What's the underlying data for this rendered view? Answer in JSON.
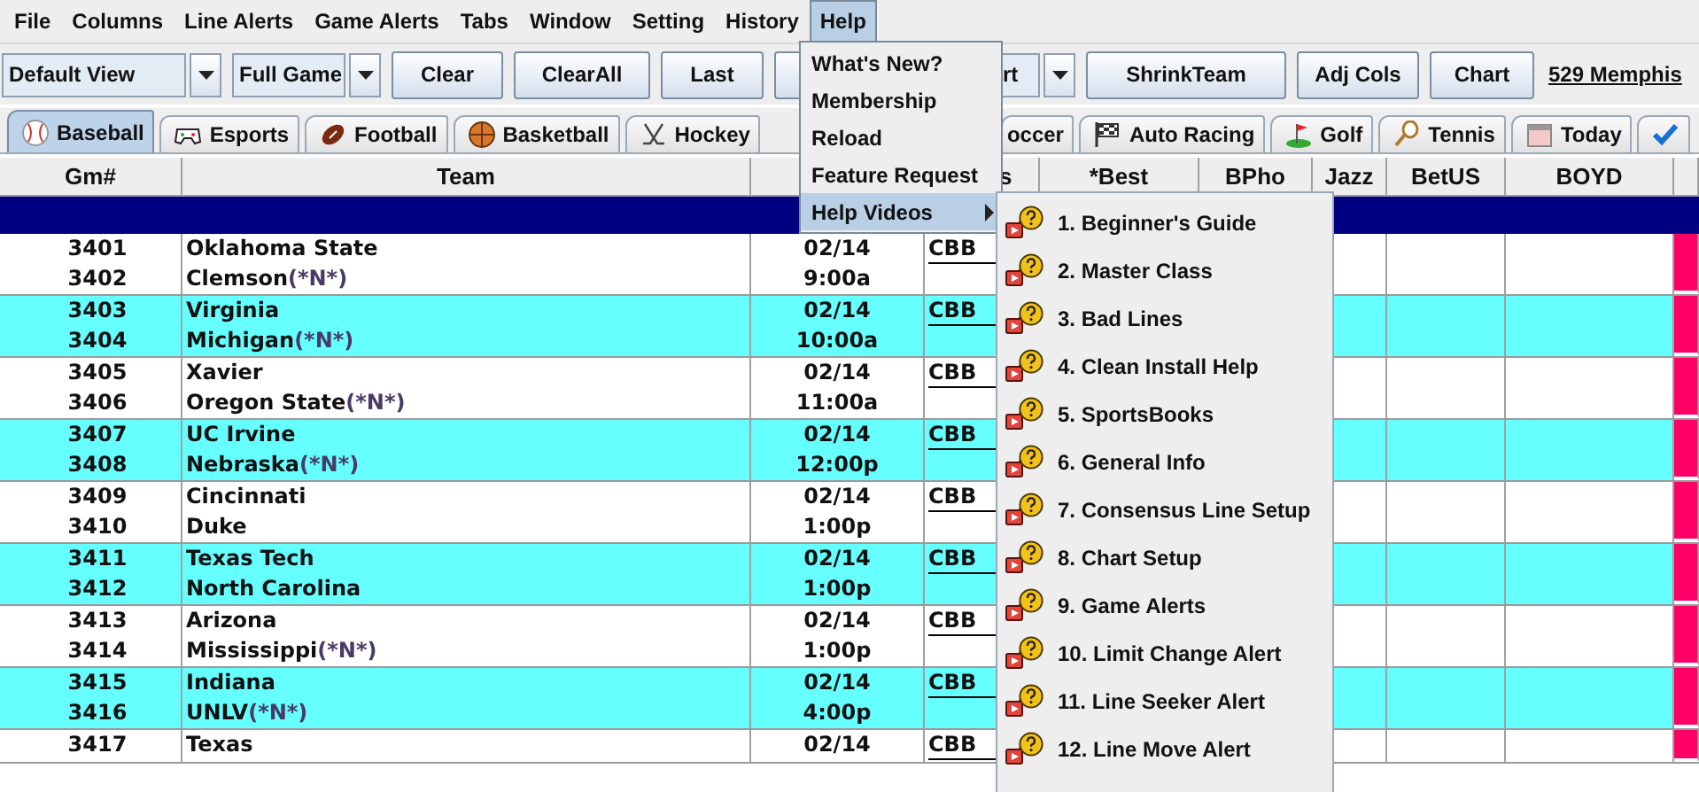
{
  "menubar": [
    {
      "label": "File",
      "selected": false
    },
    {
      "label": "Columns",
      "selected": false
    },
    {
      "label": "Line Alerts",
      "selected": false
    },
    {
      "label": "Game Alerts",
      "selected": false
    },
    {
      "label": "Tabs",
      "selected": false
    },
    {
      "label": "Window",
      "selected": false
    },
    {
      "label": "Setting",
      "selected": false
    },
    {
      "label": "History",
      "selected": false
    },
    {
      "label": "Help",
      "selected": true
    }
  ],
  "toolbar": [
    {
      "kind": "combo",
      "value": "Default View"
    },
    {
      "kind": "combo",
      "value": "Full Game"
    },
    {
      "kind": "button",
      "label": "Clear"
    },
    {
      "kind": "button",
      "label": "ClearAll"
    },
    {
      "kind": "button",
      "label": "Last"
    },
    {
      "kind": "button"
    },
    {
      "kind": "combo",
      "value": "rt"
    },
    {
      "kind": "button",
      "label": "ShrinkTeam"
    },
    {
      "kind": "button",
      "label": "Adj Cols"
    },
    {
      "kind": "button",
      "label": "Chart"
    },
    {
      "kind": "link",
      "label": "529 Memphis"
    }
  ],
  "tabs": [
    {
      "kind": "baseball",
      "label": "Baseball",
      "selected": true
    },
    {
      "kind": "esports",
      "label": "Esports",
      "selected": false
    },
    {
      "kind": "football",
      "label": "Football",
      "selected": false
    },
    {
      "kind": "basketball",
      "label": "Basketball",
      "selected": false
    },
    {
      "kind": "hockey",
      "label": "Hockey",
      "selected": false
    },
    {
      "kind": "hidden"
    },
    {
      "kind": "plain",
      "label": "occer",
      "selected": false
    },
    {
      "kind": "racing",
      "label": "Auto Racing",
      "selected": false
    },
    {
      "kind": "golf",
      "label": "Golf",
      "selected": false
    },
    {
      "kind": "tennis",
      "label": "Tennis",
      "selected": false
    },
    {
      "kind": "calendar",
      "label": "Today",
      "selected": false
    },
    {
      "kind": "check",
      "selected": false
    }
  ],
  "table": {
    "columns": [
      "Gm#",
      "Team",
      "s",
      "*Best",
      "BPho",
      "Jazz",
      "BetUS",
      "BOYD"
    ],
    "games": [
      {
        "numbers": [
          "3401",
          "3402"
        ],
        "teams": [
          {
            "name": "Oklahoma State"
          },
          {
            "name": "Clemson",
            "tag": "(*N*)"
          }
        ],
        "date": "02/14",
        "time": "9:00a",
        "league": "CBB"
      },
      {
        "numbers": [
          "3403",
          "3404"
        ],
        "teams": [
          {
            "name": "Virginia"
          },
          {
            "name": "Michigan",
            "tag": "(*N*)"
          }
        ],
        "date": "02/14",
        "time": "10:00a",
        "league": "CBB"
      },
      {
        "numbers": [
          "3405",
          "3406"
        ],
        "teams": [
          {
            "name": "Xavier"
          },
          {
            "name": "Oregon State",
            "tag": "(*N*)"
          }
        ],
        "date": "02/14",
        "time": "11:00a",
        "league": "CBB"
      },
      {
        "numbers": [
          "3407",
          "3408"
        ],
        "teams": [
          {
            "name": "UC Irvine"
          },
          {
            "name": "Nebraska",
            "tag": "(*N*)"
          }
        ],
        "date": "02/14",
        "time": "12:00p",
        "league": "CBB"
      },
      {
        "numbers": [
          "3409",
          "3410"
        ],
        "teams": [
          {
            "name": "Cincinnati"
          },
          {
            "name": "Duke"
          }
        ],
        "date": "02/14",
        "time": "1:00p",
        "league": "CBB"
      },
      {
        "numbers": [
          "3411",
          "3412"
        ],
        "teams": [
          {
            "name": "Texas Tech"
          },
          {
            "name": "North Carolina"
          }
        ],
        "date": "02/14",
        "time": "1:00p",
        "league": "CBB"
      },
      {
        "numbers": [
          "3413",
          "3414"
        ],
        "teams": [
          {
            "name": "Arizona"
          },
          {
            "name": "Mississippi",
            "tag": "(*N*)"
          }
        ],
        "date": "02/14",
        "time": "1:00p",
        "league": "CBB"
      },
      {
        "numbers": [
          "3415",
          "3416"
        ],
        "teams": [
          {
            "name": "Indiana"
          },
          {
            "name": "UNLV",
            "tag": "(*N*)"
          }
        ],
        "date": "02/14",
        "time": "4:00p",
        "league": "CBB"
      },
      {
        "numbers": [
          "3417"
        ],
        "teams": [
          {
            "name": "Texas"
          }
        ],
        "date": "02/14",
        "league": "CBB"
      }
    ]
  },
  "help_menu": [
    {
      "label": "What's New?",
      "kind": "item",
      "selected": false
    },
    {
      "label": "Membership",
      "kind": "item",
      "selected": false
    },
    {
      "label": "Reload",
      "kind": "item",
      "selected": false
    },
    {
      "label": "Feature Request",
      "kind": "item",
      "selected": false
    },
    {
      "label": "Help Videos",
      "kind": "submenu",
      "selected": true
    }
  ],
  "help_videos_menu": [
    "1. Beginner's Guide",
    "2. Master Class",
    "3. Bad Lines",
    "4. Clean Install Help",
    "5. SportsBooks",
    "6. General Info",
    "7. Consensus Line Setup",
    "8. Chart Setup",
    "9. Game Alerts",
    "10. Limit Change Alert",
    "11. Line Seeker Alert",
    "12. Line Move Alert"
  ]
}
